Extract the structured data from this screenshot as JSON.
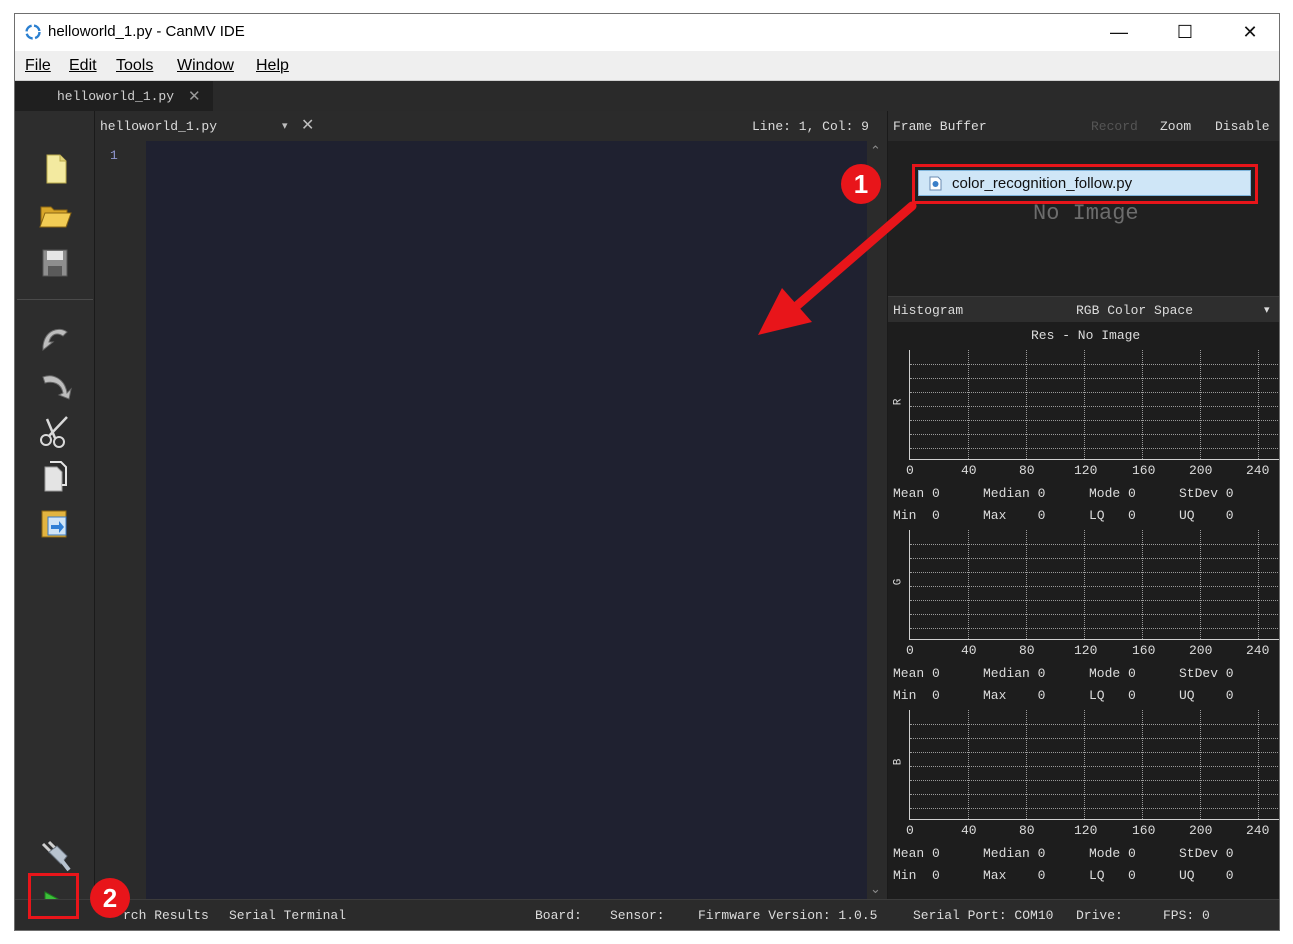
{
  "window": {
    "title": "helloworld_1.py - CanMV IDE",
    "controls": {
      "minimize": "—",
      "maximize": "☐",
      "close": "✕"
    }
  },
  "menu": [
    "File",
    "Edit",
    "Tools",
    "Window",
    "Help"
  ],
  "tab": {
    "label": "helloworld_1.py",
    "close": "✕"
  },
  "editor": {
    "file": "helloworld_1.py",
    "dropdown": "▾",
    "close": "✕",
    "position": "Line: 1, Col: 9",
    "line_numbers": [
      "1"
    ]
  },
  "toolbar": {
    "icons": [
      "new-file-icon",
      "open-folder-icon",
      "save-icon",
      "undo-icon",
      "redo-icon",
      "cut-icon",
      "copy-icon",
      "paste-icon",
      "connect-icon",
      "run-icon"
    ]
  },
  "framebuffer": {
    "title": "Frame Buffer",
    "record": "Record",
    "zoom": "Zoom",
    "disable": "Disable",
    "placeholder": "No Image"
  },
  "histogram": {
    "title": "Histogram",
    "color_space": "RGB Color Space",
    "dropdown": "▾",
    "resolution": "Res - No Image",
    "ticks": [
      "0",
      "40",
      "80",
      "120",
      "160",
      "200",
      "240"
    ],
    "channels": [
      {
        "name": "R",
        "mean": "Mean 0",
        "median": "Median 0",
        "mode": "Mode 0",
        "stdev": "StDev 0",
        "min": "Min  0",
        "max": "Max    0",
        "lq": "LQ   0",
        "uq": "UQ    0"
      },
      {
        "name": "G",
        "mean": "Mean 0",
        "median": "Median 0",
        "mode": "Mode 0",
        "stdev": "StDev 0",
        "min": "Min  0",
        "max": "Max    0",
        "lq": "LQ   0",
        "uq": "UQ    0"
      },
      {
        "name": "B",
        "mean": "Mean 0",
        "median": "Median 0",
        "mode": "Mode 0",
        "stdev": "StDev 0",
        "min": "Min  0",
        "max": "Max    0",
        "lq": "LQ   0",
        "uq": "UQ    0"
      }
    ]
  },
  "status": {
    "search": "rch Results",
    "serial_terminal": "Serial Terminal",
    "board": "Board:",
    "sensor": "Sensor:",
    "firmware": "Firmware Version: 1.0.5",
    "serial_port": "Serial Port: COM10",
    "drive": "Drive:",
    "fps": "FPS: 0"
  },
  "annotation": {
    "step1": "1",
    "step2": "2",
    "dragged_file": "color_recognition_follow.py",
    "accent": "#e8151a"
  }
}
